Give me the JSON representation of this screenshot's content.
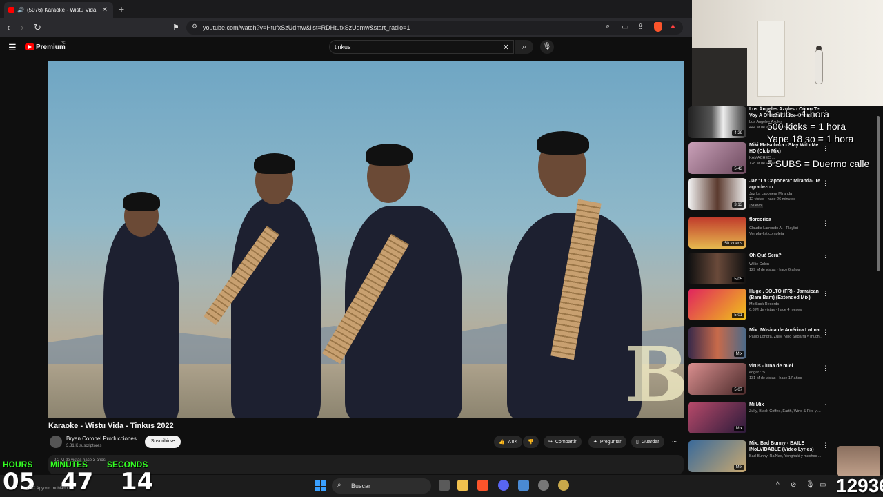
{
  "browser": {
    "tab_title": "(5076) Karaoke - Wistu Vida",
    "url": "youtube.com/watch?v=HtufxSzUdmw&list=RDHtufxSzUdmw&start_radio=1"
  },
  "youtube": {
    "brand": "Premium",
    "brand_region": "PE",
    "search_value": "tinkus"
  },
  "video": {
    "title": "Karaoke - Wistu Vida - Tinkus 2022",
    "channel": "Bryan Coronel Producciones",
    "subscribers": "3.81 K suscriptores",
    "subscribe_label": "Suscribirse",
    "likes": "7.8K",
    "share_label": "Compartir",
    "ask_label": "Preguntar",
    "save_label": "Guardar",
    "views_meta": "2.2 M de vistas  hace 3 años",
    "watermark": "B"
  },
  "sidebar": {
    "items": [
      {
        "title": "Los Ángeles Azules - Cómo Te Voy A Olvidar (Video Oficial)",
        "channel": "Los Ángeles Azules",
        "meta": "444 M de vistas · hace 10 años",
        "badge": "4:29"
      },
      {
        "title": "Miki Matsubara - Stay With Me HD (Club Mix)",
        "channel": "KAMACHEC ...",
        "meta": "128 M de vistas",
        "badge": "5:43"
      },
      {
        "title": "Jaz \"La Caponera\" Miranda- Te agradezco",
        "channel": "Jaz La caponera Miranda",
        "meta": "12 vistas · hace 26 minutos",
        "extra": "Nuevo",
        "badge": "3:13"
      },
      {
        "title": "florcorica",
        "channel": "Claudia Larrondo A. · Playlist",
        "meta": "Ver playlist completa",
        "badge": "50 videos"
      },
      {
        "title": "Oh Qué Será?",
        "channel": "Willie Colón",
        "meta": "129 M de vistas · hace 6 años",
        "badge": "5:05"
      },
      {
        "title": "Hugel, SOLTO (FR) - Jamaican (Bam Bam) (Extended Mix)",
        "channel": "MoBlack Records",
        "meta": "6.8 M de vistas · hace 4 meses",
        "badge": "5:01"
      },
      {
        "title": "Mix: Música de América Latina",
        "channel": "Paulo Londra, Zully, Nino Segarra y much...",
        "meta": "",
        "badge": "Mix"
      },
      {
        "title": "virus - luna de miel",
        "channel": "edgar775",
        "meta": "131 M de vistas · hace 17 años",
        "badge": "5:07"
      },
      {
        "title": "Mi Mix",
        "channel": "Zully, Black Coffee, Earth, Wind & Fire y ...",
        "meta": "",
        "badge": "Mix"
      },
      {
        "title": "Mix: Bad Bunny - BAILE INoLVIDABLE (Video Lyrics)",
        "channel": "Bad Bunny, RaiNao, Yonghaki y muchos ...",
        "meta": "",
        "badge": "Mix"
      }
    ]
  },
  "overlay": {
    "line1": "1 sub = 1 hora",
    "line2": "500 kicks = 1 hora",
    "line3": "Yape 18 so = 1 hora",
    "line4": "5 SUBS = Duermo calle"
  },
  "timer": {
    "hours_label": "HOURS",
    "minutes_label": "MINUTES",
    "seconds_label": "SECONDS",
    "hours": "05",
    "minutes": "47",
    "seconds": "14"
  },
  "weather": {
    "temp": "22°C",
    "desc": "Apyorm. nublado"
  },
  "counter": "12936",
  "taskbar": {
    "search_label": "Buscar"
  },
  "colors": {
    "yt_red": "#ff0000",
    "timer_green": "#33ff22",
    "bg": "#0f0f0f"
  }
}
